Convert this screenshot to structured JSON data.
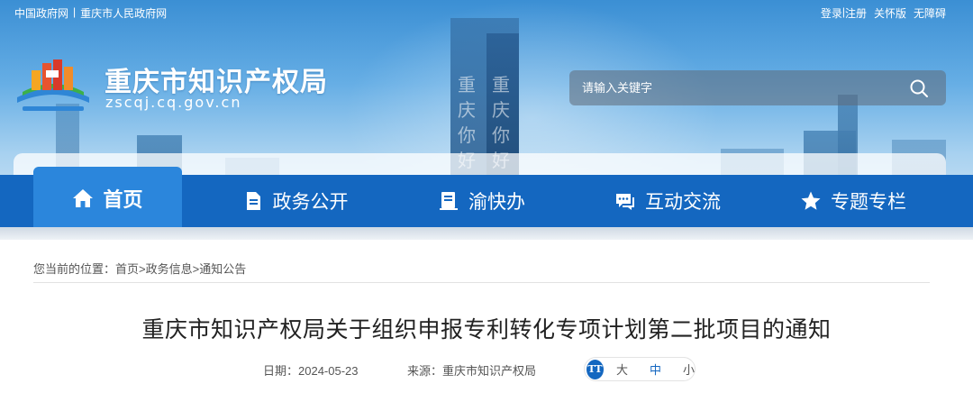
{
  "topbar": {
    "links_left": [
      "中国政府网",
      "重庆市人民政府网"
    ],
    "separator": "|",
    "links_right": [
      "登录",
      "注册",
      "关怀版",
      "无障碍"
    ]
  },
  "header": {
    "site_title": "重庆市知识产权局",
    "site_domain": "zscqj.cq.gov.cn",
    "tower_text_left": "重庆你好",
    "tower_text_right": "重庆你好"
  },
  "search": {
    "placeholder": "请输入关键字",
    "icon": "search-icon"
  },
  "nav": {
    "items": [
      {
        "label": "首页",
        "icon": "home-icon"
      },
      {
        "label": "政务公开",
        "icon": "document-icon"
      },
      {
        "label": "渝快办",
        "icon": "book-icon"
      },
      {
        "label": "互动交流",
        "icon": "chat-icon"
      },
      {
        "label": "专题专栏",
        "icon": "star-icon"
      }
    ]
  },
  "breadcrumb": {
    "prefix": "您当前的位置：",
    "items": [
      "首页",
      "政务信息",
      "通知公告"
    ],
    "separator": ">"
  },
  "article": {
    "title": "重庆市知识产权局关于组织申报专利转化专项计划第二批项目的通知",
    "date_label": "日期：",
    "date": "2024-05-23",
    "source_label": "来源：",
    "source": "重庆市知识产权局"
  },
  "font_size": {
    "icon_text": "TT",
    "options": [
      "大",
      "中",
      "小"
    ],
    "selected": "中"
  },
  "colors": {
    "nav_bg": "#1467c0",
    "nav_active": "#2b86dc",
    "accent": "#1467c0"
  }
}
